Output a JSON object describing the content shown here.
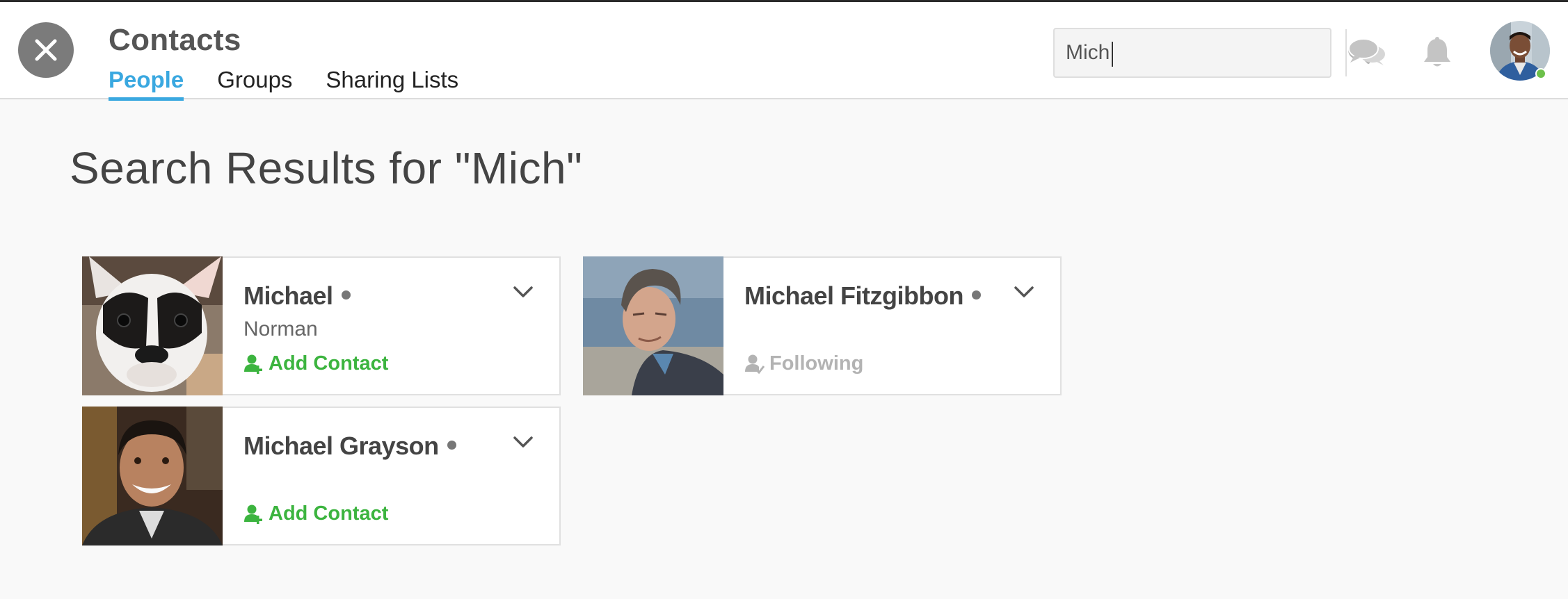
{
  "header": {
    "title": "Contacts",
    "tabs": [
      {
        "label": "People",
        "active": true
      },
      {
        "label": "Groups",
        "active": false
      },
      {
        "label": "Sharing Lists",
        "active": false
      }
    ],
    "search_value": "Mich",
    "icons": [
      "close-icon",
      "search-icon",
      "chat-icon",
      "bell-icon"
    ],
    "accent_color": "#3aa8e0",
    "online_color": "#6cc04a"
  },
  "results": {
    "title": "Search Results for \"Mich\"",
    "cards": [
      {
        "name": "Michael",
        "subtitle": "Norman",
        "action": "Add Contact",
        "action_type": "add",
        "photo": "french-bulldog"
      },
      {
        "name": "Michael Fitzgibbon",
        "subtitle": "",
        "action": "Following",
        "action_type": "following",
        "photo": "older-man-seaside"
      },
      {
        "name": "Michael Grayson",
        "subtitle": "",
        "action": "Add Contact",
        "action_type": "add",
        "photo": "smiling-man"
      }
    ],
    "add_color": "#3cb43f",
    "following_color": "#b3b3b3"
  }
}
